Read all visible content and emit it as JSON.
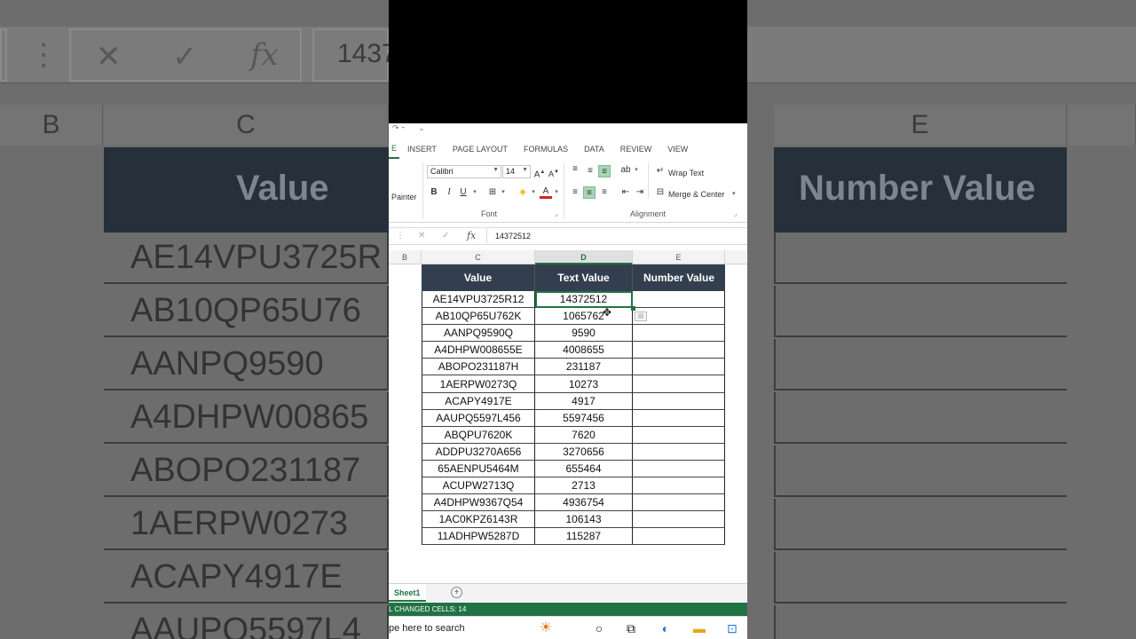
{
  "background": {
    "formula_value_fragment": "1437",
    "col_b": "B",
    "col_c": "C",
    "col_e": "E",
    "head_value": "Value",
    "head_number": "Number Value",
    "cells": [
      "AE14VPU3725R",
      "AB10QP65U76",
      "AANPQ9590",
      "A4DHPW00865",
      "ABOPO231187",
      "1AERPW0273",
      "ACAPY4917E",
      "AAUPQ5597L4"
    ]
  },
  "ribbon": {
    "tab_partial": "E",
    "tabs": [
      "INSERT",
      "PAGE LAYOUT",
      "FORMULAS",
      "DATA",
      "REVIEW",
      "VIEW"
    ],
    "painter_label": "Painter",
    "font_name": "Calibri",
    "font_size": "14",
    "font_group_label": "Font",
    "alignment_group_label": "Alignment",
    "wrap_text": "Wrap Text",
    "merge_center": "Merge & Center"
  },
  "formula_bar": {
    "fx": "fx",
    "value": "14372512"
  },
  "columns": {
    "b": "B",
    "c": "C",
    "d": "D",
    "e": "E"
  },
  "table": {
    "headers": [
      "Value",
      "Text Value",
      "Number Value"
    ],
    "rows": [
      [
        "AE14VPU3725R12",
        "14372512",
        ""
      ],
      [
        "AB10QP65U762K",
        "1065762",
        ""
      ],
      [
        "AANPQ9590Q",
        "9590",
        ""
      ],
      [
        "A4DHPW008655E",
        "4008655",
        ""
      ],
      [
        "ABOPO231187H",
        "231187",
        ""
      ],
      [
        "1AERPW0273Q",
        "10273",
        ""
      ],
      [
        "ACAPY4917E",
        "4917",
        ""
      ],
      [
        "AAUPQ5597L456",
        "5597456",
        ""
      ],
      [
        "ABQPU7620K",
        "7620",
        ""
      ],
      [
        "ADDPU3270A656",
        "3270656",
        ""
      ],
      [
        "65AENPU5464M",
        "655464",
        ""
      ],
      [
        "ACUPW2713Q",
        "2713",
        ""
      ],
      [
        "A4DHPW9367Q54",
        "4936754",
        ""
      ],
      [
        "1AC0KPZ6143R",
        "106143",
        ""
      ],
      [
        "11ADHPW5287D",
        "115287",
        ""
      ]
    ]
  },
  "sheet_tab": "Sheet1",
  "status_text": "L CHANGED CELLS: 14",
  "taskbar": {
    "search_text": "pe here to search"
  },
  "colors": {
    "accent": "#217346",
    "header_bg": "#333f4f"
  }
}
